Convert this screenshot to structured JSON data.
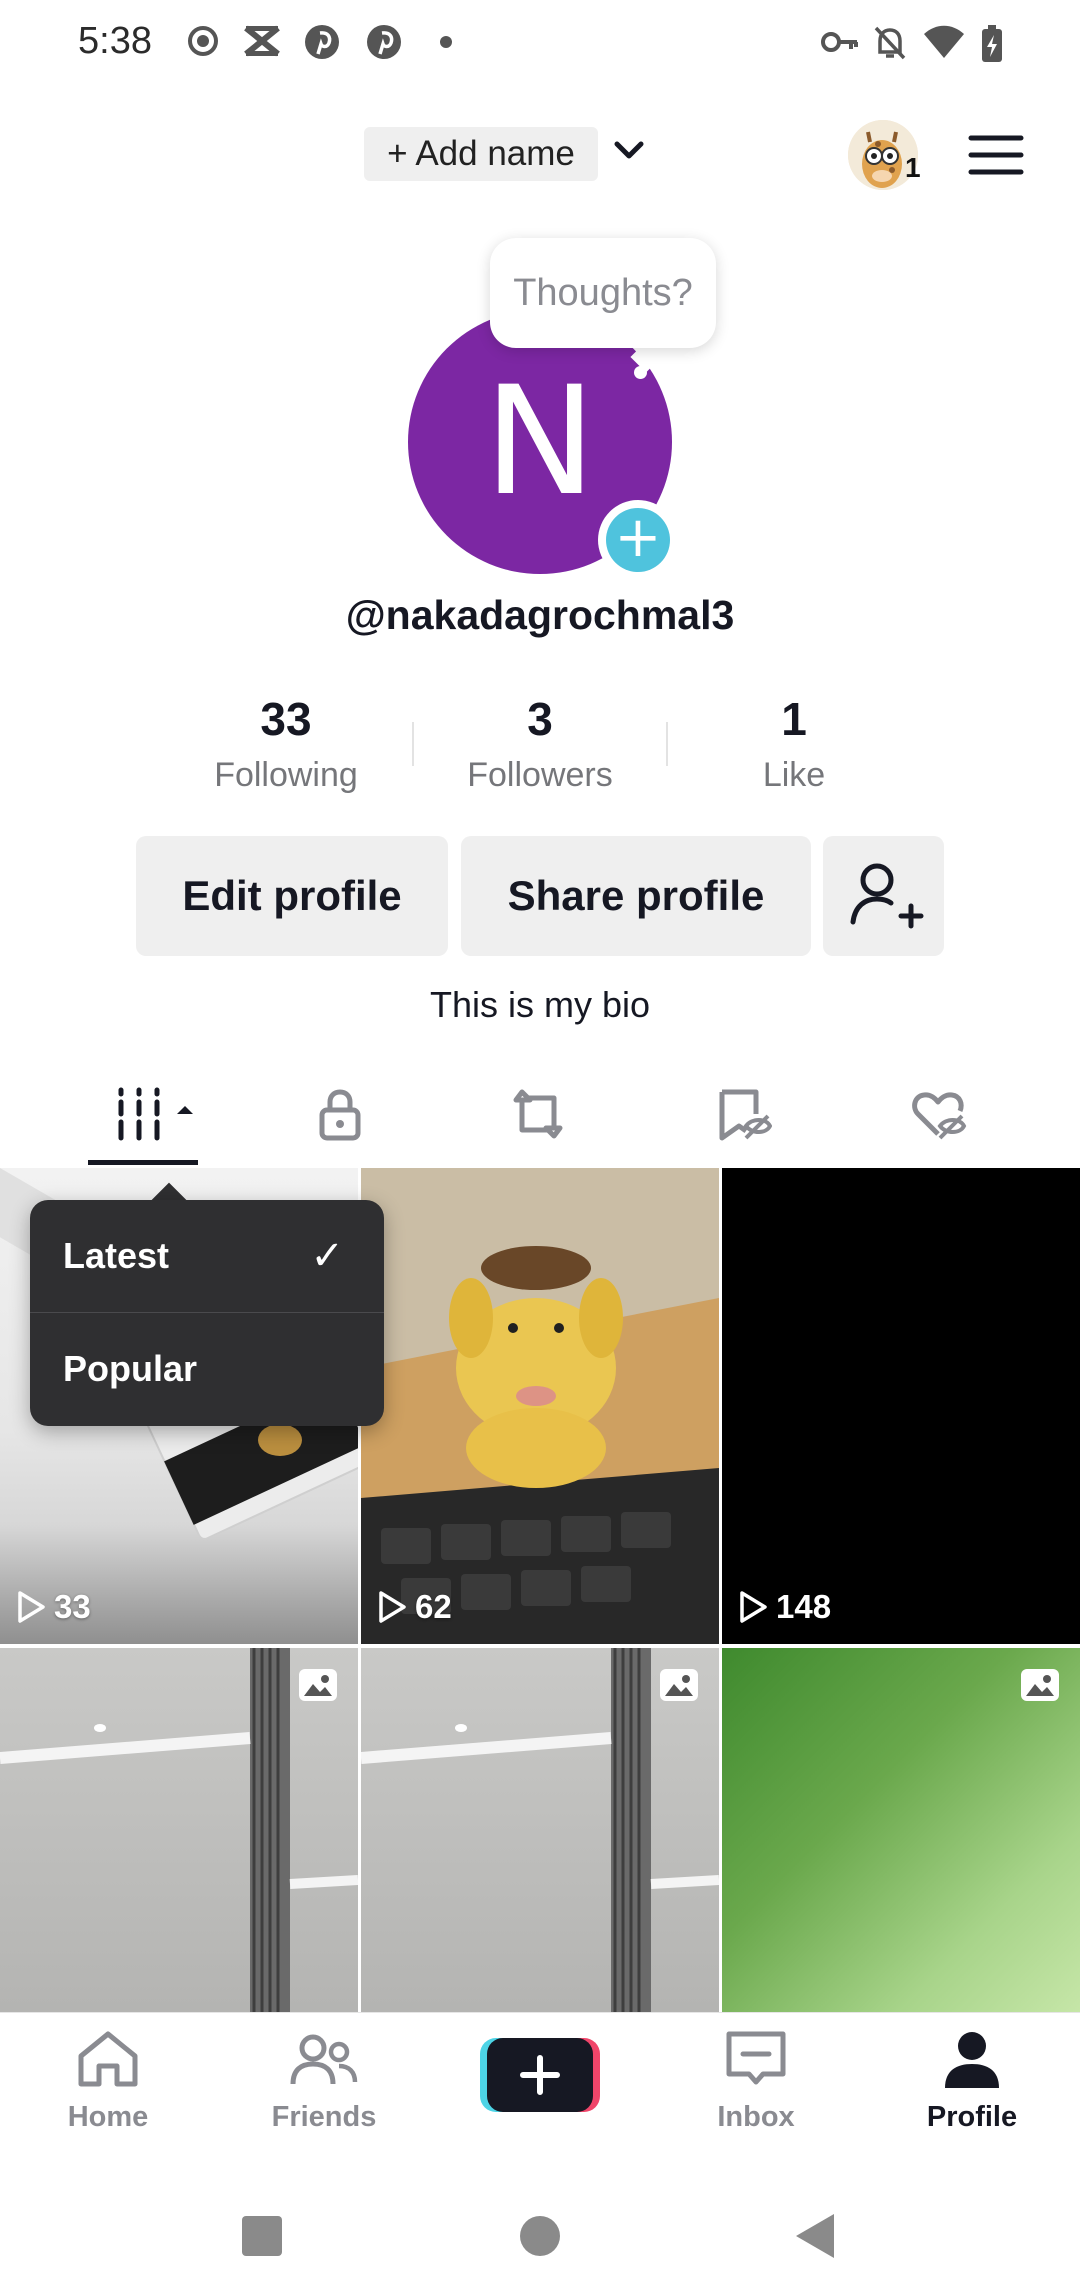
{
  "status_bar": {
    "time": "5:38",
    "left_icons": [
      "circle-record-icon",
      "x-mark-icon",
      "pinterest-icon",
      "pinterest-icon",
      "dot-icon"
    ],
    "right_icons": [
      "key-icon",
      "bell-off-icon",
      "wifi-icon",
      "battery-charging-icon"
    ]
  },
  "header": {
    "add_name_label": "+ Add name",
    "friends_badge_count": "1"
  },
  "avatar": {
    "initial": "N",
    "color": "#7c27a3",
    "thoughts_bubble": "Thoughts?"
  },
  "profile": {
    "username": "@nakadagrochmal3",
    "bio": "This is my bio",
    "stats": [
      {
        "value": "33",
        "label": "Following"
      },
      {
        "value": "3",
        "label": "Followers"
      },
      {
        "value": "1",
        "label": "Like"
      }
    ],
    "edit_profile_label": "Edit profile",
    "share_profile_label": "Share profile"
  },
  "tabs": [
    "videos-grid-icon",
    "lock-icon",
    "repost-icon",
    "favorites-hidden-icon",
    "liked-hidden-icon"
  ],
  "sort_menu": {
    "items": [
      {
        "label": "Latest",
        "selected": true,
        "check": "✓"
      },
      {
        "label": "Popular",
        "selected": false
      }
    ]
  },
  "grid": {
    "videos": [
      {
        "views": "33"
      },
      {
        "views": "62"
      },
      {
        "views": "148"
      }
    ]
  },
  "bottom_nav": {
    "items": [
      {
        "label": "Home"
      },
      {
        "label": "Friends"
      },
      {
        "label": ""
      },
      {
        "label": "Inbox"
      },
      {
        "label": "Profile"
      }
    ]
  },
  "colors": {
    "accent_cyan": "#25f4ee",
    "accent_pink": "#fe2c55",
    "plus_blue": "#4fc3dd"
  }
}
